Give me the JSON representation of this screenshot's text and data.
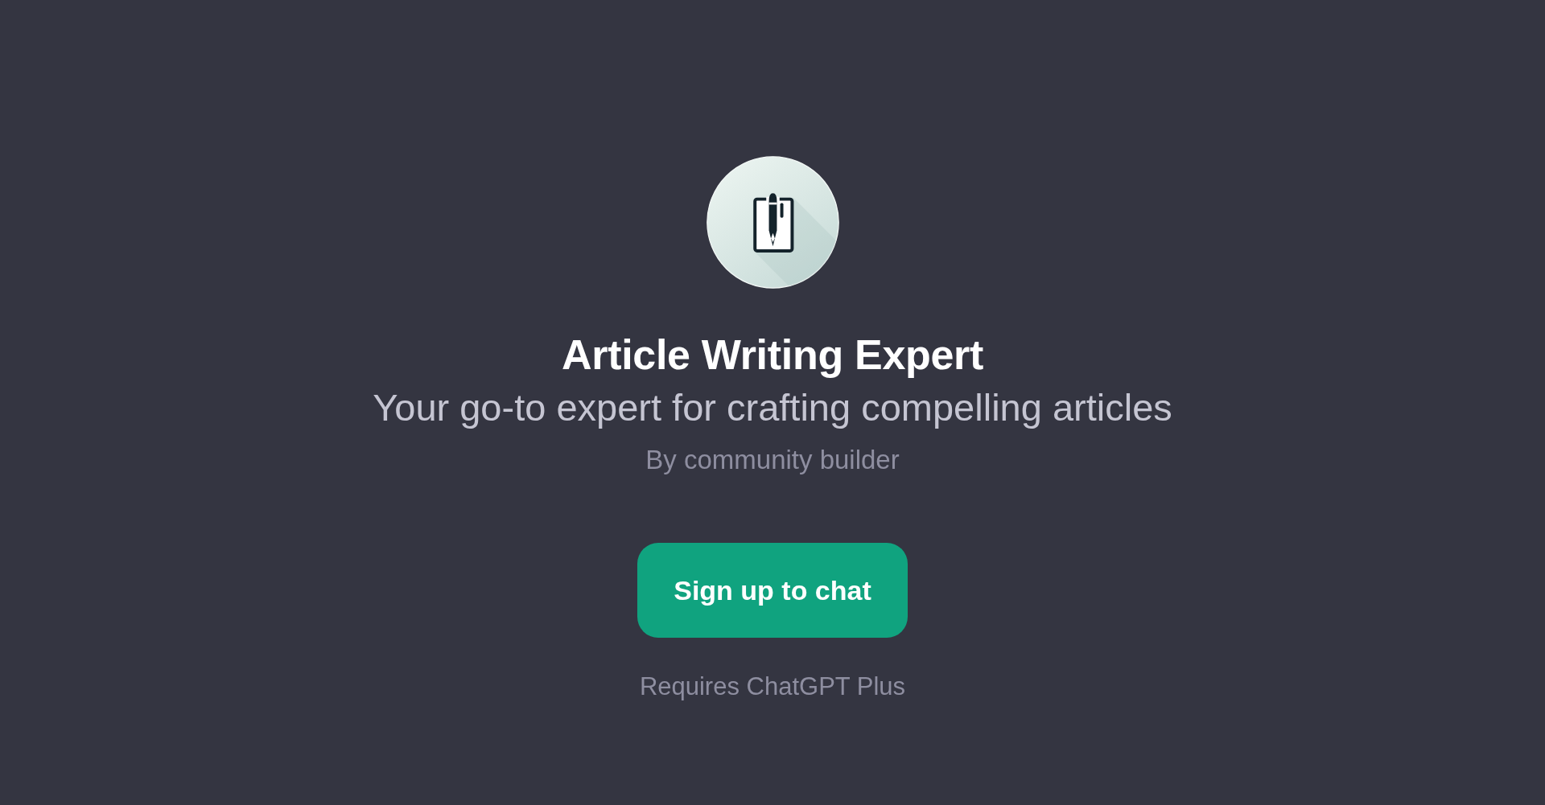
{
  "gpt": {
    "name": "Article Writing Expert",
    "description": "Your go-to expert for crafting compelling articles",
    "author": "By community builder"
  },
  "signup_button": {
    "label": "Sign up to chat"
  },
  "requirement_note": "Requires ChatGPT Plus"
}
